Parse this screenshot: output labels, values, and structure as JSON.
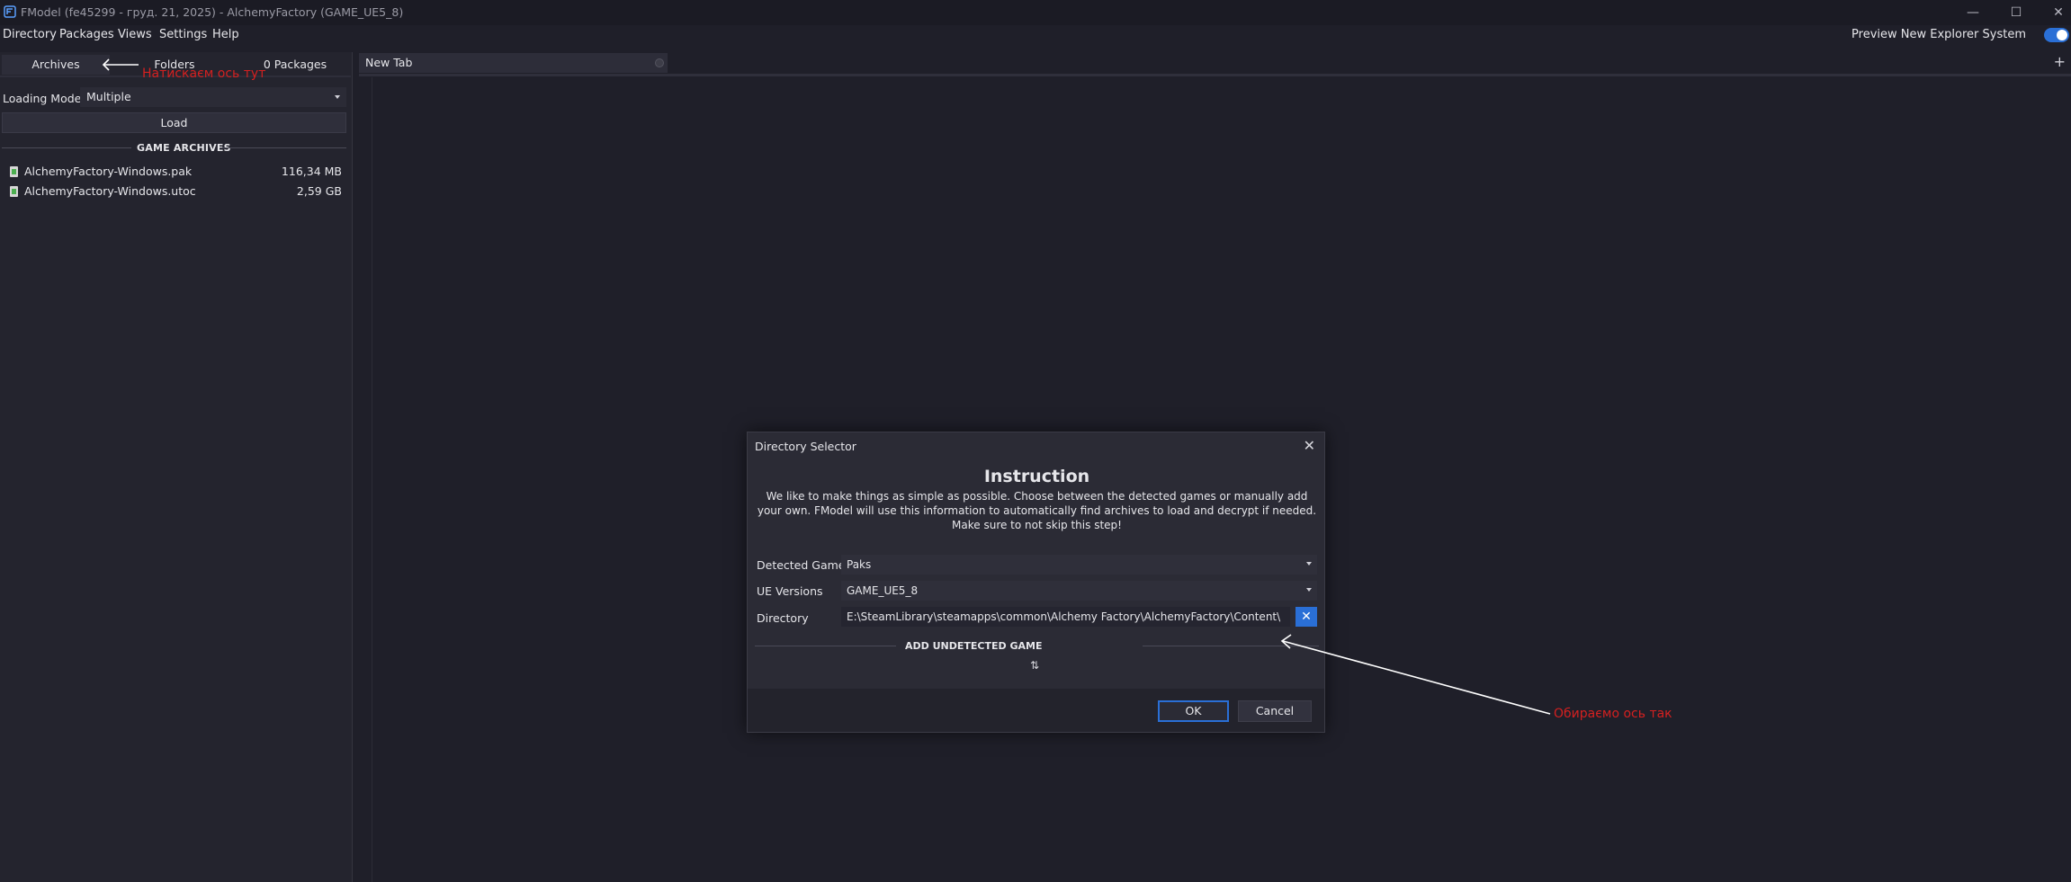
{
  "window": {
    "title": "FModel (fe45299 - груд. 21, 2025) - AlchemyFactory (GAME_UE5_8)"
  },
  "menu": {
    "items": [
      "Directory",
      "Packages",
      "Views",
      "Settings",
      "Help"
    ],
    "preview_label": "Preview New Explorer System",
    "preview_enabled": true
  },
  "left_panel": {
    "tabs": [
      "Archives",
      "Folders",
      "0 Packages"
    ],
    "active_tab": "Archives",
    "loading_mode_label": "Loading Mode",
    "loading_mode_value": "Multiple",
    "load_button": "Load",
    "section_title": "GAME ARCHIVES",
    "files": [
      {
        "name": "AlchemyFactory-Windows.pak",
        "size": "116,34 MB"
      },
      {
        "name": "AlchemyFactory-Windows.utoc",
        "size": "2,59 GB"
      }
    ]
  },
  "main": {
    "tab_label": "New Tab"
  },
  "annotations": {
    "top_note": "Натискаєм ось тут",
    "dialog_note": "Обираємо ось так"
  },
  "dialog": {
    "title": "Directory Selector",
    "heading": "Instruction",
    "description": "We like to make things as simple as possible. Choose between the detected games or manually add your own. FModel will use this information to automatically find archives to load and decrypt if needed. Make sure to not skip this step!",
    "detected_game_label": "Detected Game",
    "detected_game_value": "Paks",
    "ue_versions_label": "UE Versions",
    "ue_versions_value": "GAME_UE5_8",
    "directory_label": "Directory",
    "directory_value": "E:\\SteamLibrary\\steamapps\\common\\Alchemy Factory\\AlchemyFactory\\Content\\",
    "add_undetected": "ADD UNDETECTED GAME",
    "ok_button": "OK",
    "cancel_button": "Cancel"
  },
  "colors": {
    "accent": "#2a6fd6",
    "annotation": "#d42020",
    "background": "#1f1f29"
  }
}
